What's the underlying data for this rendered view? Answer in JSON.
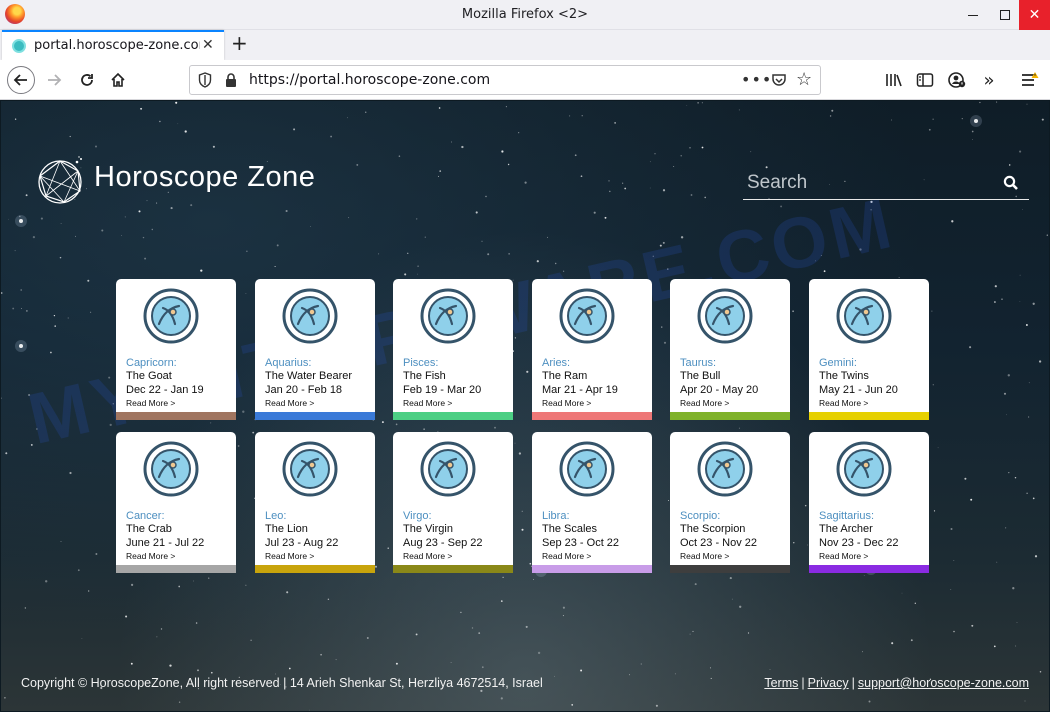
{
  "window": {
    "title": "Mozilla Firefox <2>"
  },
  "tab": {
    "label": "portal.horoscope-zone.com"
  },
  "urlbar": {
    "url": "https://portal.horoscope-zone.com",
    "dots": "•••"
  },
  "site": {
    "title": "Horoscope Zone",
    "search_placeholder": "Search",
    "watermark": "MYANTISPYWARE.COM"
  },
  "signs": [
    {
      "name": "Capricorn:",
      "nickname": "The Goat",
      "dates": "Dec 22 - Jan 19",
      "more": "Read More >",
      "color": "#a07560"
    },
    {
      "name": "Aquarius:",
      "nickname": "The Water Bearer",
      "dates": "Jan 20 - Feb 18",
      "more": "Read More >",
      "color": "#3a7ad8"
    },
    {
      "name": "Pisces:",
      "nickname": "The Fish",
      "dates": "Feb 19 - Mar 20",
      "more": "Read More >",
      "color": "#4ccf84"
    },
    {
      "name": "Aries:",
      "nickname": "The Ram",
      "dates": "Mar 21 - Apr 19",
      "more": "Read More >",
      "color": "#ee7777"
    },
    {
      "name": "Taurus:",
      "nickname": "The Bull",
      "dates": "Apr 20 - May 20",
      "more": "Read More >",
      "color": "#7fb22a"
    },
    {
      "name": "Gemini:",
      "nickname": "The Twins",
      "dates": "May 21 - Jun 20",
      "more": "Read More >",
      "color": "#e6d000"
    },
    {
      "name": "Cancer:",
      "nickname": "The Crab",
      "dates": "June 21 - Jul 22",
      "more": "Read More >",
      "color": "#a6a6a6"
    },
    {
      "name": "Leo:",
      "nickname": "The Lion",
      "dates": "Jul 23 - Aug 22",
      "more": "Read More >",
      "color": "#c8a40c"
    },
    {
      "name": "Virgo:",
      "nickname": "The Virgin",
      "dates": "Aug 23 - Sep 22",
      "more": "Read More >",
      "color": "#8a8818"
    },
    {
      "name": "Libra:",
      "nickname": "The Scales",
      "dates": "Sep 23 - Oct 22",
      "more": "Read More >",
      "color": "#c89ce8"
    },
    {
      "name": "Scorpio:",
      "nickname": "The Scorpion",
      "dates": "Oct 23 - Nov 22",
      "more": "Read More >",
      "color": "#3e3e3e"
    },
    {
      "name": "Sagittarius:",
      "nickname": "The Archer",
      "dates": "Nov 23 - Dec 22",
      "more": "Read More >",
      "color": "#8a2be2"
    }
  ],
  "footer": {
    "copyright": "Copyright © HoroscopeZone, All right reserved | 14 Arieh Shenkar St, Herzliya 4672514, Israel",
    "terms": "Terms",
    "privacy": "Privacy",
    "email": "support@horoscope-zone.com",
    "separator": "|"
  },
  "icons": {
    "firefox": "firefox-logo-icon",
    "tab_favicon": "favicon-icon",
    "close": "close-icon",
    "new_tab": "plus-icon",
    "back": "back-arrow-icon",
    "forward": "forward-arrow-icon",
    "reload": "reload-icon",
    "home": "home-icon",
    "shield": "shield-icon",
    "lock": "lock-icon",
    "pocket": "pocket-icon",
    "bookmark": "star-icon",
    "library": "library-icon",
    "sidebar": "sidebar-icon",
    "account": "account-warning-icon",
    "overflow": "overflow-chevron-icon",
    "menu": "hamburger-menu-icon",
    "search": "search-icon",
    "zodiac": "zodiac-sign-icon"
  }
}
